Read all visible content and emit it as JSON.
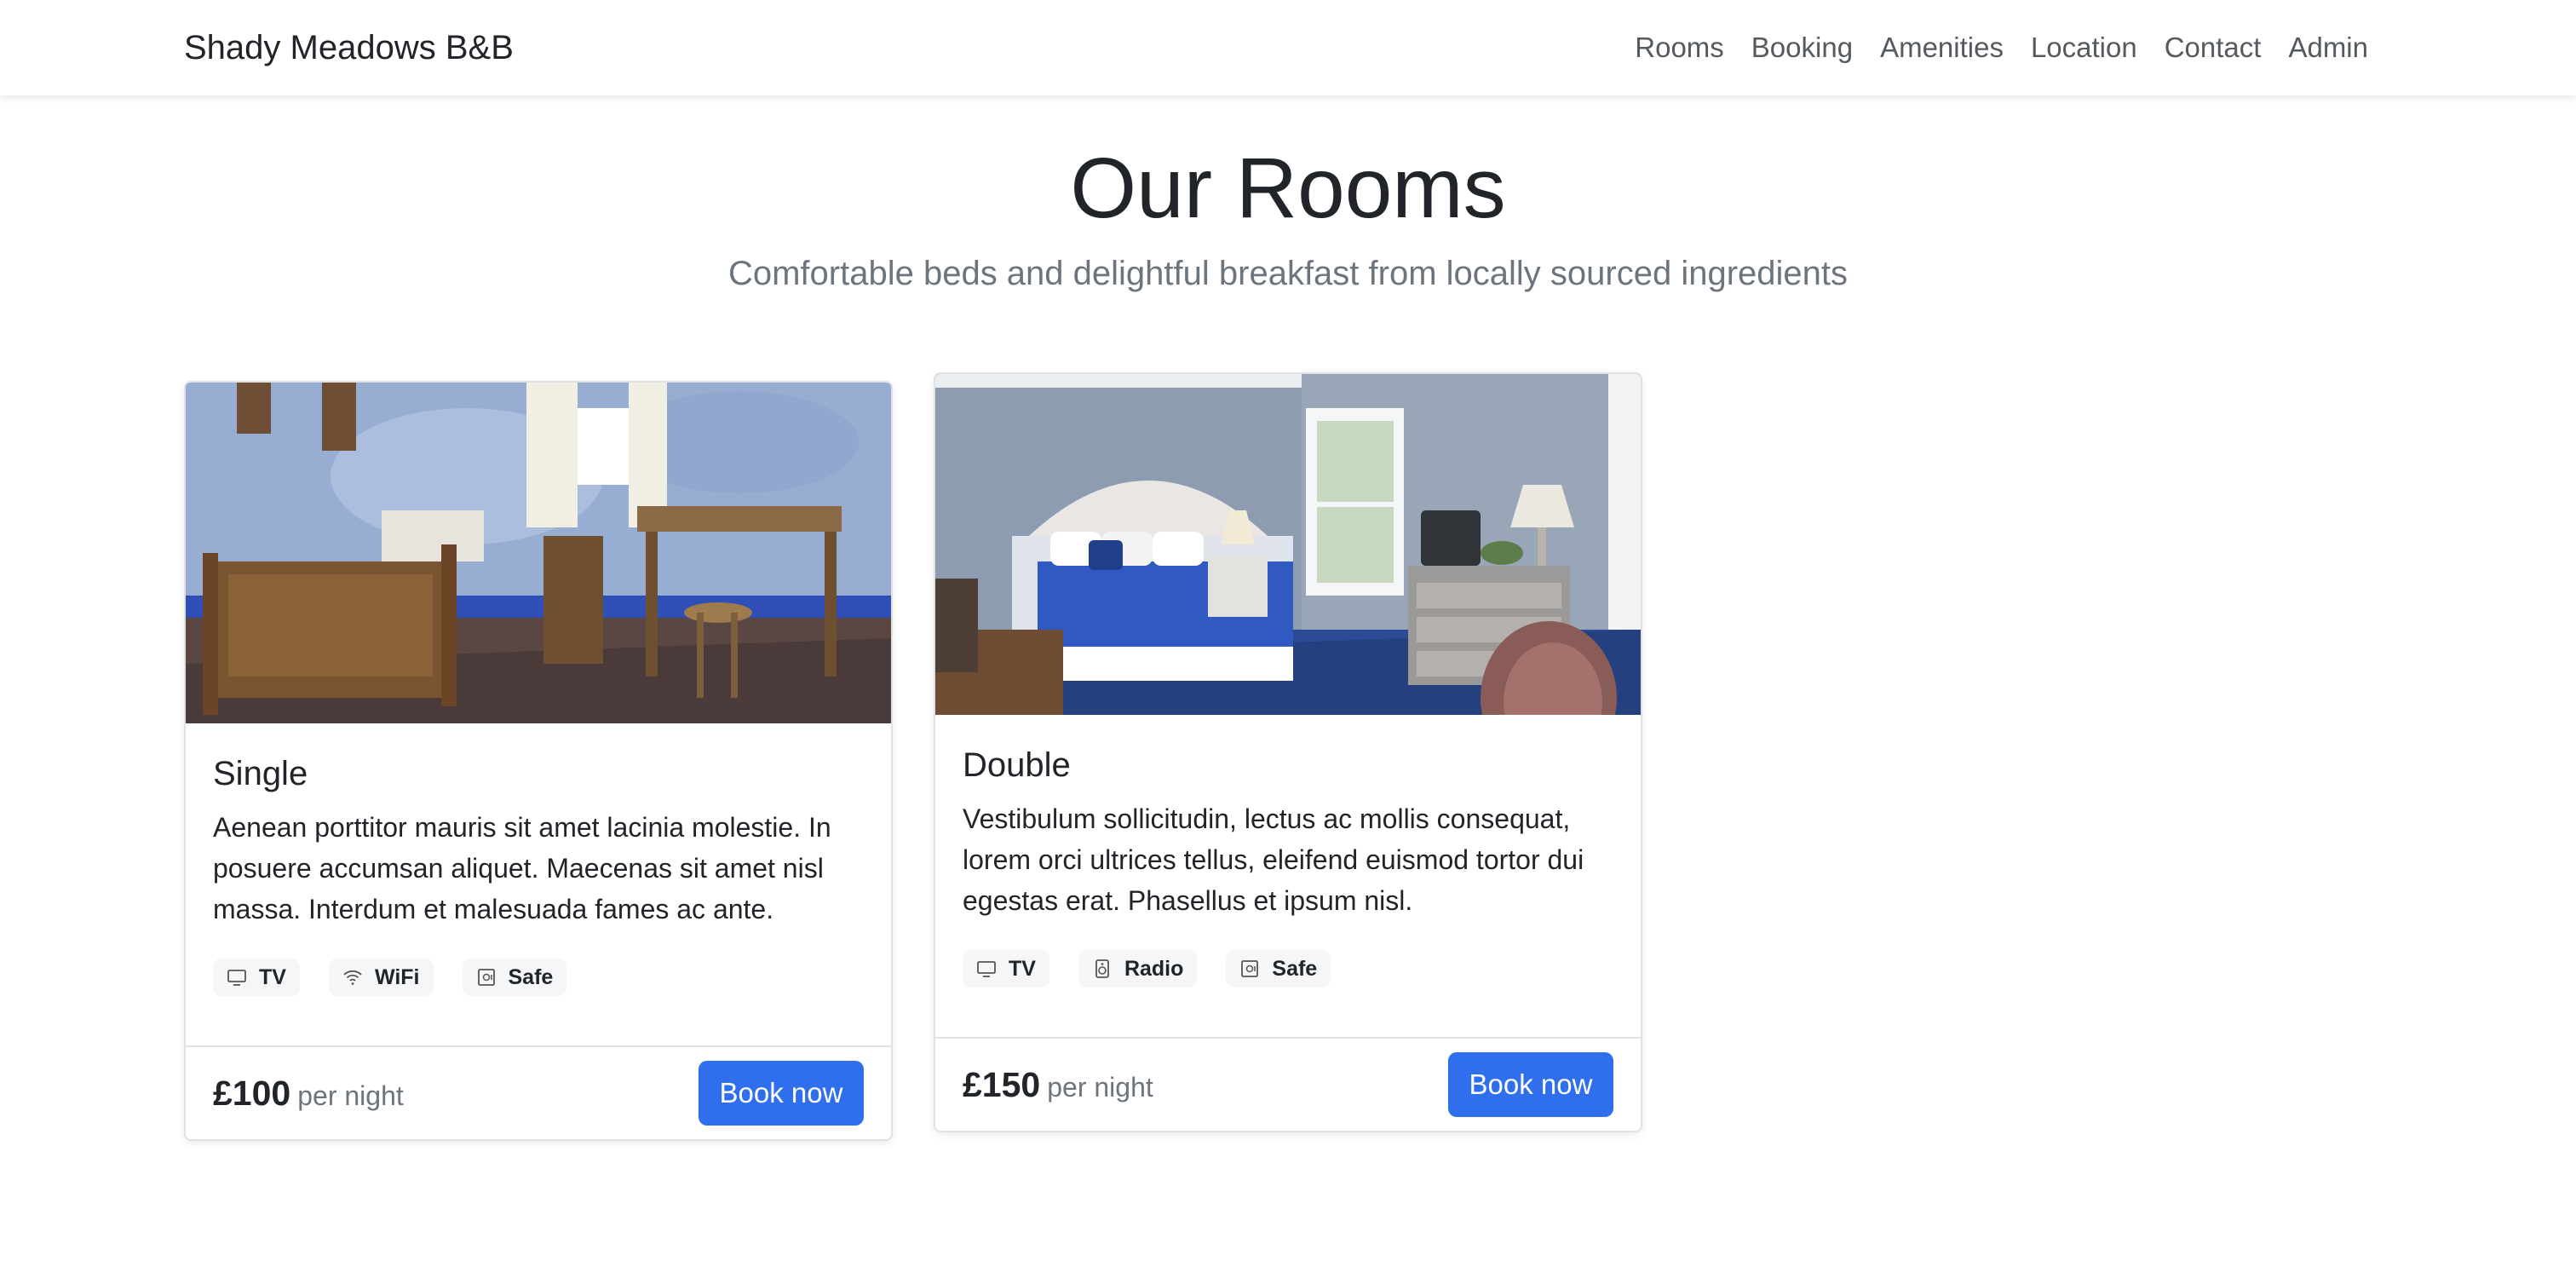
{
  "navbar": {
    "brand": "Shady Meadows B&B",
    "links": [
      "Rooms",
      "Booking",
      "Amenities",
      "Location",
      "Contact",
      "Admin"
    ]
  },
  "hero": {
    "title": "Our Rooms",
    "subtitle": "Comfortable beds and delightful breakfast from locally sourced ingredients"
  },
  "rooms": [
    {
      "title": "Single",
      "description": "Aenean porttitor mauris sit amet lacinia molestie. In posuere accumsan aliquet. Maecenas sit amet nisl massa. Interdum et malesuada fames ac ante.",
      "features": [
        {
          "icon": "tv-icon",
          "label": "TV"
        },
        {
          "icon": "wifi-icon",
          "label": "WiFi"
        },
        {
          "icon": "safe-icon",
          "label": "Safe"
        }
      ],
      "price": "£100",
      "price_suffix": "per night",
      "button": "Book now"
    },
    {
      "title": "Double",
      "description": "Vestibulum sollicitudin, lectus ac mollis consequat, lorem orci ultrices tellus, eleifend euismod tortor dui egestas erat. Phasellus et ipsum nisl.",
      "features": [
        {
          "icon": "tv-icon",
          "label": "TV"
        },
        {
          "icon": "radio-icon",
          "label": "Radio"
        },
        {
          "icon": "safe-icon",
          "label": "Safe"
        }
      ],
      "price": "£150",
      "price_suffix": "per night",
      "button": "Book now"
    }
  ],
  "colors": {
    "accent": "#2f6fee",
    "muted_text": "#6c757d",
    "border": "#dfe1e4"
  }
}
